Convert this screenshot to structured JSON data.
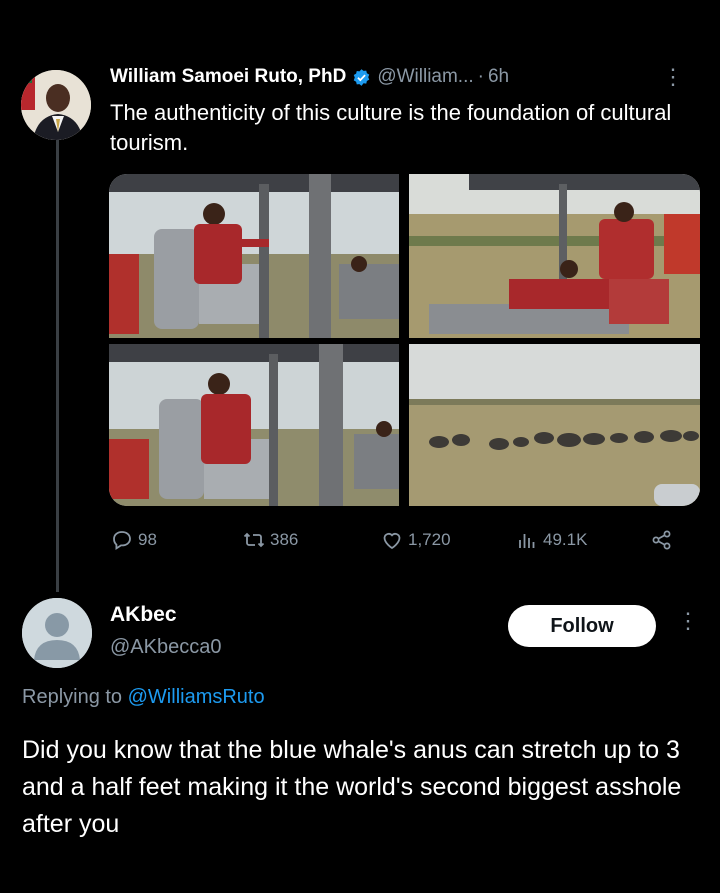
{
  "tweet": {
    "author_name": "William Samoei Ruto, PhD",
    "author_handle": "@William...",
    "separator": "·",
    "time": "6h",
    "text": "The authenticity of this culture is the foundation of cultural tourism.",
    "stats": {
      "replies": "98",
      "retweets": "386",
      "likes": "1,720",
      "views": "49.1K"
    }
  },
  "reply": {
    "author_name": "AKbec",
    "author_handle": "@AKbecca0",
    "follow_label": "Follow",
    "replying_prefix": "Replying to",
    "replying_mention": "@WilliamsRuto",
    "text": "Did you know that the blue whale's anus can stretch up to 3 and a half feet making it the world's second biggest asshole after you"
  },
  "colors": {
    "background": "#000000",
    "verified_badge": "#1d9bf0",
    "muted_text": "#8b98a5",
    "link": "#1d9bf0"
  },
  "icons": [
    "verified-badge-icon",
    "more-icon",
    "reply-icon",
    "retweet-icon",
    "like-icon",
    "views-icon",
    "share-icon"
  ]
}
